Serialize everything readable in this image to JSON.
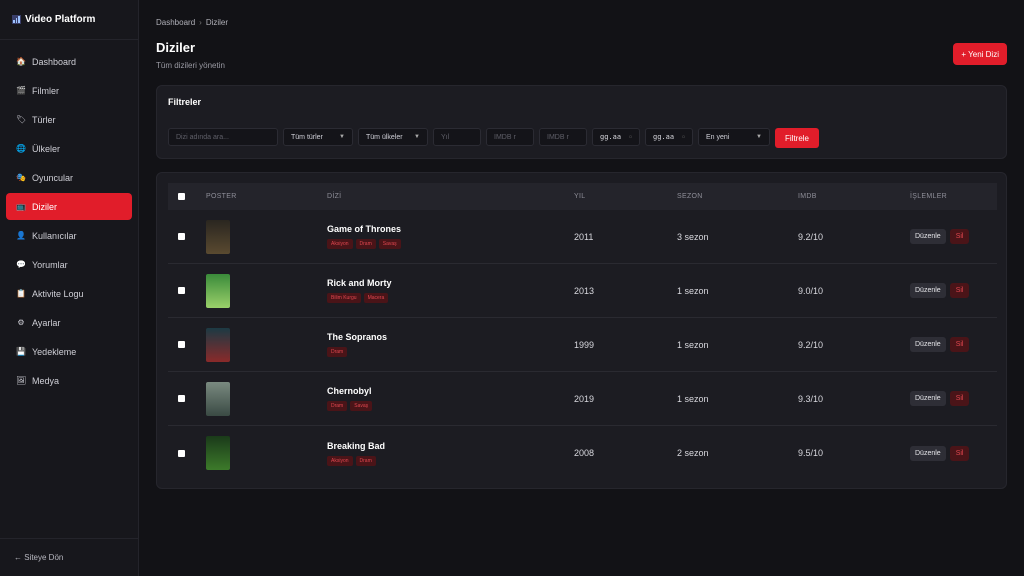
{
  "app": {
    "title": "Video Platform"
  },
  "sidebar": {
    "items": [
      {
        "label": "Dashboard",
        "icon": "🏠"
      },
      {
        "label": "Filmler",
        "icon": "🎬"
      },
      {
        "label": "Türler",
        "icon": "🏷"
      },
      {
        "label": "Ülkeler",
        "icon": "🌐"
      },
      {
        "label": "Oyuncular",
        "icon": "🎭"
      },
      {
        "label": "Diziler",
        "icon": "📺"
      },
      {
        "label": "Kullanıcılar",
        "icon": "👤"
      },
      {
        "label": "Yorumlar",
        "icon": "💬"
      },
      {
        "label": "Aktivite Logu",
        "icon": "📋"
      },
      {
        "label": "Ayarlar",
        "icon": "⚙"
      },
      {
        "label": "Yedekleme",
        "icon": "💾"
      },
      {
        "label": "Medya",
        "icon": "🖼"
      }
    ],
    "active_index": 5,
    "footer_label": "← Siteye Dön"
  },
  "header": {
    "breadcrumb": [
      "Dashboard",
      "Diziler"
    ],
    "breadcrumb_sep": "›",
    "title": "Diziler",
    "subtitle": "Tüm dizileri yönetin",
    "new_button": "+ Yeni Dizi"
  },
  "filters": {
    "title": "Filtreler",
    "search_placeholder": "Dizi adında ara...",
    "genre_selected": "Tüm türler",
    "country_selected": "Tüm ülkeler",
    "year_placeholder": "Yıl",
    "imdb_min_placeholder": "IMDB r",
    "imdb_max_placeholder": "IMDB r",
    "date_from": "gg.aa",
    "date_to": "gg.aa",
    "sort_selected": "En yeni",
    "submit": "Filtrele"
  },
  "table": {
    "headers": {
      "poster": "POSTER",
      "title": "DİZİ",
      "year": "YIL",
      "season": "SEZON",
      "imdb": "IMDB",
      "actions": "İŞLEMLER"
    },
    "edit_label": "Düzenle",
    "delete_label": "Sil",
    "rows": [
      {
        "title": "Game of Thrones",
        "tags": [
          "Aksiyon",
          "Dram",
          "Savaş"
        ],
        "year": "2011",
        "seasons": "3 sezon",
        "imdb": "9.2/10",
        "poster_colors": [
          "#2a2620",
          "#5a4a30"
        ]
      },
      {
        "title": "Rick and Morty",
        "tags": [
          "Bilim Kurgu",
          "Macera"
        ],
        "year": "2013",
        "seasons": "1 sezon",
        "imdb": "9.0/10",
        "poster_colors": [
          "#3a8a3a",
          "#9ad06a"
        ]
      },
      {
        "title": "The Sopranos",
        "tags": [
          "Dram"
        ],
        "year": "1999",
        "seasons": "1 sezon",
        "imdb": "9.2/10",
        "poster_colors": [
          "#1c3a44",
          "#8a2a2a"
        ]
      },
      {
        "title": "Chernobyl",
        "tags": [
          "Dram",
          "Savaş"
        ],
        "year": "2019",
        "seasons": "1 sezon",
        "imdb": "9.3/10",
        "poster_colors": [
          "#7a8a80",
          "#3a4a44"
        ]
      },
      {
        "title": "Breaking Bad",
        "tags": [
          "Aksiyon",
          "Dram"
        ],
        "year": "2008",
        "seasons": "2 sezon",
        "imdb": "9.5/10",
        "poster_colors": [
          "#1a3a1a",
          "#3c7a2a"
        ]
      }
    ]
  },
  "colors": {
    "accent": "#e11d2a",
    "tag_bg": "#4a1418",
    "tag_text": "#e0474f"
  }
}
